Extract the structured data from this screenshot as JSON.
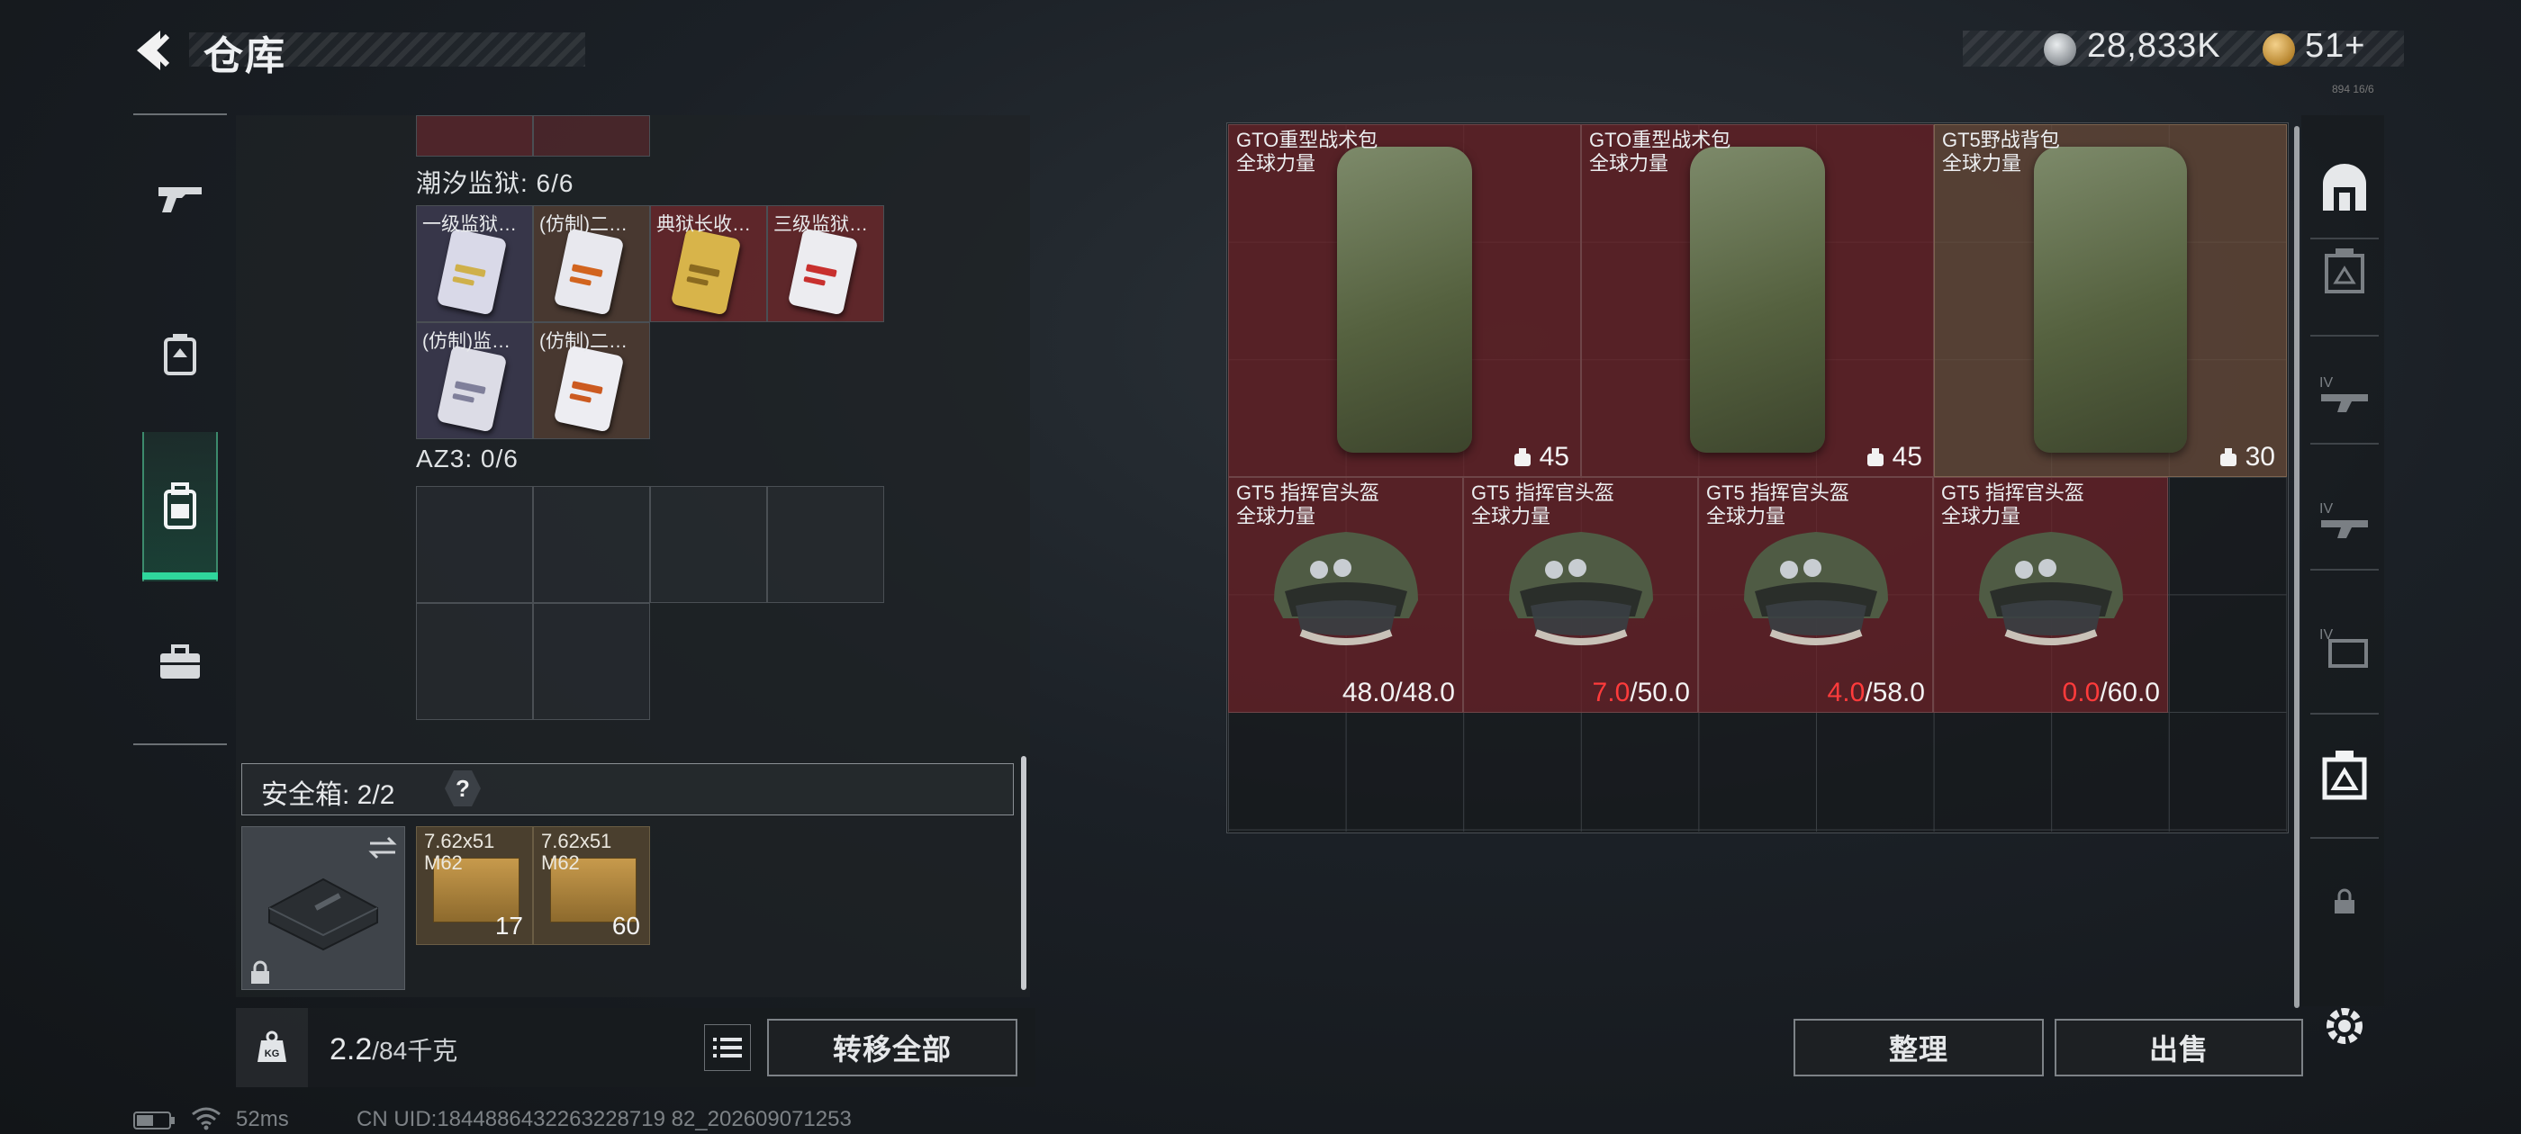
{
  "header": {
    "title": "仓库"
  },
  "currency": {
    "silver": "28,833K",
    "gold": "51+",
    "tiny_tag": "894 16/6"
  },
  "left_nav": [
    "gun-icon",
    "bag-tag-icon",
    "backpack-icon",
    "toolbox-icon"
  ],
  "sections": {
    "chaoxi": {
      "label": "潮汐监狱: 6/6",
      "items": [
        {
          "label": "一级监狱…",
          "card": "#d9d9e8",
          "stripe": "#cfb04a"
        },
        {
          "label": "(仿制)二…",
          "card": "#e8e8ee",
          "stripe": "#d2641e"
        },
        {
          "label": "典狱长收…",
          "card": "#d8b44a",
          "stripe": "#8a6a20"
        },
        {
          "label": "三级监狱…",
          "card": "#ececf0",
          "stripe": "#c8302e"
        },
        {
          "label": "(仿制)监…",
          "card": "#dcdce6",
          "stripe": "#7f7f9a"
        },
        {
          "label": "(仿制)二…",
          "card": "#ededf2",
          "stripe": "#cc5a20"
        }
      ]
    },
    "az3": {
      "label": "AZ3: 0/6"
    },
    "safe": {
      "label": "安全箱: 2/2",
      "help": "?",
      "ammo": [
        {
          "label1": "7.62x51",
          "label2": "M62",
          "count": "17"
        },
        {
          "label1": "7.62x51",
          "label2": "M62",
          "count": "60"
        }
      ]
    }
  },
  "bottom_left": {
    "weight_current": "2.2",
    "weight_rest": "/84千克",
    "transfer_all": "转移全部",
    "kg_icon_text": "KG"
  },
  "status": {
    "ping": "52ms",
    "uid": "CN UID:1844886432263228719 82_202609071253"
  },
  "stash": {
    "backpacks": [
      {
        "name": "GTO重型战术包",
        "faction": "全球力量",
        "count": "45"
      },
      {
        "name": "GTO重型战术包",
        "faction": "全球力量",
        "count": "45"
      },
      {
        "name": "GT5野战背包",
        "faction": "全球力量",
        "count": "30"
      }
    ],
    "helmets": [
      {
        "name": "GT5 指挥官头盔",
        "faction": "全球力量",
        "current": "48.0",
        "max": "/48.0",
        "low": false
      },
      {
        "name": "GT5 指挥官头盔",
        "faction": "全球力量",
        "current": "7.0",
        "max": "/50.0",
        "low": true
      },
      {
        "name": "GT5 指挥官头盔",
        "faction": "全球力量",
        "current": "4.0",
        "max": "/58.0",
        "low": true
      },
      {
        "name": "GT5 指挥官头盔",
        "faction": "全球力量",
        "current": "0.0",
        "max": "/60.0",
        "low": true
      }
    ]
  },
  "bottom_right": {
    "sort": "整理",
    "sell": "出售"
  },
  "right_nav": [
    "armor-icon",
    "vest-icon",
    "iv-rifle-icon",
    "iv-rifle-icon-2",
    "iv-folder-icon",
    "vest-active-icon",
    "lock-icon",
    "settings-icon"
  ],
  "colors": {
    "accent_green": "#2fd69c",
    "item_red": "#6e2228",
    "low_durability": "#ff3b3b"
  }
}
